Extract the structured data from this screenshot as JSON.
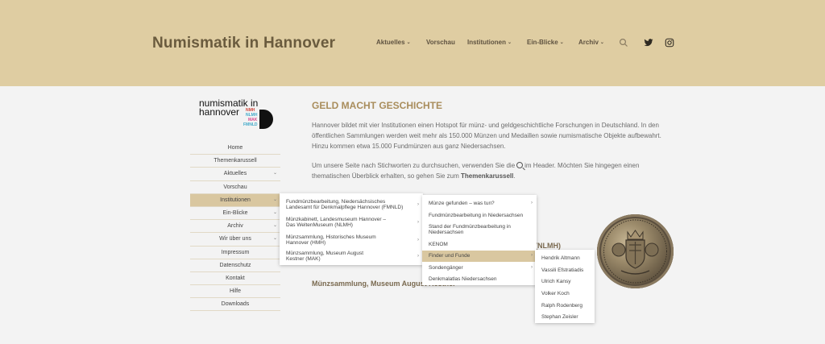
{
  "header": {
    "title": "Numismatik in Hannover",
    "nav": [
      {
        "label": "Aktuelles",
        "dropdown": true
      },
      {
        "label": "Vorschau",
        "dropdown": false
      },
      {
        "label": "Institutionen",
        "dropdown": true
      },
      {
        "label": "Ein-Blicke",
        "dropdown": true
      },
      {
        "label": "Archiv",
        "dropdown": true
      }
    ],
    "icons": [
      "search-icon",
      "twitter-icon",
      "instagram-icon"
    ]
  },
  "logo": {
    "line1": "numismatik in",
    "line2": "hannover",
    "side": [
      "NMH",
      "NLMH",
      "MAK",
      "FMNLD"
    ],
    "side_colors": [
      "#d0453a",
      "#3fa9c9",
      "#d84a8e",
      "#3fa9c9"
    ]
  },
  "sidemenu": [
    {
      "label": "Home"
    },
    {
      "label": "Themenkarussell"
    },
    {
      "label": "Aktuelles",
      "chev": true
    },
    {
      "label": "Vorschau"
    },
    {
      "label": "Institutionen",
      "chev": true,
      "active": true
    },
    {
      "label": "Ein-Blicke",
      "chev": true
    },
    {
      "label": "Archiv",
      "chev": true
    },
    {
      "label": "Wir über uns",
      "chev": true
    },
    {
      "label": "Impressum"
    },
    {
      "label": "Datenschutz"
    },
    {
      "label": "Kontakt"
    },
    {
      "label": "Hilfe"
    },
    {
      "label": "Downloads"
    }
  ],
  "main": {
    "title": "GELD MACHT GESCHICHTE",
    "para1": "Hannover bildet mit vier Institutionen einen Hotspot für münz- und geldgeschichtliche Forschungen in Deutschland. In den öffentlichen Sammlungen werden weit mehr als 150.000 Münzen und Medaillen sowie numismatische Objekte aufbewahrt. Hinzu kommen etwa 15.000 Fundmünzen aus ganz Niedersachsen.",
    "para2_a": "Um unsere Seite nach Stichworten zu durchsuchen, verwenden Sie die",
    "para2_b": "im Header. Möchten Sie hingegen einen thematischen Überblick erhalten, so gehen Sie zum",
    "para2_link": "Themenkarussell",
    "para2_end": ".",
    "bg_partial": "(NLMH)",
    "bg_heading": "Münzsammlung, Museum August Kestner"
  },
  "dropdown1": [
    {
      "label": "Fundmünzbearbeitung, Niedersächsisches Landesamt für Denkmalpflege Hannover (FMNLD)",
      "chev": true
    },
    {
      "label": "Münzkabinett, Landesmuseum Hannover – Das WeltenMuseum (NLMH)",
      "chev": true
    },
    {
      "label": "Münzsammlung, Historisches Museum Hannover (HMH)",
      "chev": true
    },
    {
      "label": "Münzsammlung, Museum August Kestner (MAK)",
      "chev": true
    }
  ],
  "dropdown2": [
    {
      "label": "Münze gefunden – was tun?",
      "chev": true
    },
    {
      "label": "Fundmünzbearbeitung in Niedersachsen"
    },
    {
      "label": "Stand der Fundmünzbearbeitung in Niedersachsen"
    },
    {
      "label": "KENOM"
    },
    {
      "label": "Finder und Funde",
      "chev": true,
      "active": true
    },
    {
      "label": "Sondengänger",
      "chev": true
    },
    {
      "label": "Denkmalatlas Niedersachsen"
    }
  ],
  "dropdown3": [
    {
      "label": "Hendrik Altmann"
    },
    {
      "label": "Vassili Efstratiadis"
    },
    {
      "label": "Ulrich Kansy"
    },
    {
      "label": "Volker Koch"
    },
    {
      "label": "Ralph Rodenberg"
    },
    {
      "label": "Stephan Zeisler"
    }
  ]
}
